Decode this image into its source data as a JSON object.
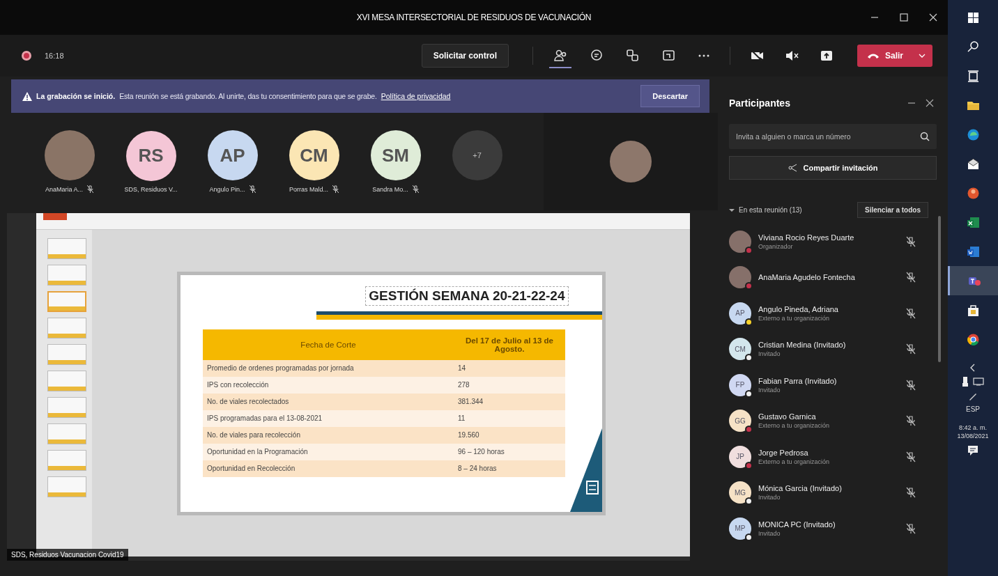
{
  "window": {
    "title": "XVI MESA INTERSECTORIAL DE RESIDUOS DE VACUNACIÓN"
  },
  "meeting_toolbar": {
    "duration": "16:18",
    "request_control": "Solicitar control",
    "tools": [
      {
        "kind": "people",
        "selected": true
      },
      {
        "kind": "chat",
        "selected": false
      },
      {
        "kind": "rooms",
        "selected": false
      },
      {
        "kind": "view",
        "selected": false
      },
      {
        "kind": "more",
        "selected": false
      }
    ],
    "devices": [
      {
        "kind": "camera-off"
      },
      {
        "kind": "speaker-muted"
      },
      {
        "kind": "share"
      }
    ],
    "leave": "Salir"
  },
  "recording_banner": {
    "title": "La grabación se inició.",
    "message": "Esta reunión se está grabando. Al unirte, das tu consentimiento para que se grabe.",
    "link": "Política de privacidad",
    "dismiss": "Descartar"
  },
  "gallery": {
    "tiles": [
      {
        "kind": "photo",
        "name": "AnaMaria A...",
        "muted": true
      },
      {
        "kind": "initials",
        "initials": "RS",
        "color": "#f4c6d6",
        "name": "SDS, Residuos V...",
        "muted": false
      },
      {
        "kind": "initials",
        "initials": "AP",
        "color": "#c7d8f0",
        "name": "Angulo Pin...",
        "muted": true
      },
      {
        "kind": "initials",
        "initials": "CM",
        "color": "#fbe6b4",
        "name": "Porras Mald...",
        "muted": true
      },
      {
        "kind": "initials",
        "initials": "SM",
        "color": "#dfecd8",
        "name": "Sandra Mo...",
        "muted": true
      }
    ],
    "overflow": "+7"
  },
  "shared_screen": {
    "thumbnails": [
      {
        "selected": false
      },
      {
        "selected": false
      },
      {
        "selected": true
      },
      {
        "selected": false
      },
      {
        "selected": false
      },
      {
        "selected": false
      },
      {
        "selected": false
      },
      {
        "selected": false
      },
      {
        "selected": false
      },
      {
        "selected": false
      }
    ],
    "slide": {
      "title": "GESTIÓN SEMANA 20-21-22-24",
      "columns": [
        "Fecha de Corte",
        "Del 17 de Julio al 13 de Agosto."
      ],
      "rows": [
        [
          "Promedio de ordenes programadas por jornada",
          "14"
        ],
        [
          "IPS con recolección",
          "278"
        ],
        [
          "No. de viales recolectados",
          "381.344"
        ],
        [
          "IPS programadas para el 13-08-2021",
          "11"
        ],
        [
          "No. de viales para recolección",
          "19.560"
        ],
        [
          "Oportunidad en la Programación",
          "96 – 120 horas"
        ],
        [
          "Oportunidad en Recolección",
          "8 – 24 horas"
        ]
      ]
    },
    "presenter_label": "SDS, Residuos Vacunacion Covid19"
  },
  "participants_panel": {
    "title": "Participantes",
    "invite_placeholder": "Invita a alguien o marca un número",
    "share_invite": "Compartir invitación",
    "section": "En esta reunión (13)",
    "mute_all": "Silenciar a todos",
    "people": [
      {
        "avatar": {
          "kind": "photo"
        },
        "name": "Viviana Rocio Reyes Duarte",
        "role": "Organizador",
        "color": "#c4314b"
      },
      {
        "avatar": {
          "kind": "photo"
        },
        "name": "AnaMaria Agudelo Fontecha",
        "color": "#c4314b"
      },
      {
        "avatar": {
          "kind": "initials",
          "initials": "AP",
          "color": "#c7d8f0"
        },
        "name": "Angulo Pineda, Adriana",
        "role": "Externo a tu organización",
        "color": "#f8d22a"
      },
      {
        "avatar": {
          "kind": "initials",
          "initials": "CM",
          "color": "#d3e6ec"
        },
        "name": "Cristian Medina (Invitado)",
        "role": "Invitado",
        "color": "#f0f0f0"
      },
      {
        "avatar": {
          "kind": "initials",
          "initials": "FP",
          "color": "#d0d8f2"
        },
        "name": "Fabian Parra (Invitado)",
        "role": "Invitado",
        "color": "#f0f0f0"
      },
      {
        "avatar": {
          "kind": "initials",
          "initials": "GG",
          "color": "#f6e2c6"
        },
        "name": "Gustavo Garnica",
        "role": "Externo a tu organización",
        "color": "#c4314b"
      },
      {
        "avatar": {
          "kind": "initials",
          "initials": "JP",
          "color": "#f0dede"
        },
        "name": "Jorge Pedrosa",
        "role": "Externo a tu organización",
        "color": "#c4314b"
      },
      {
        "avatar": {
          "kind": "initials",
          "initials": "MG",
          "color": "#f6e2c6"
        },
        "name": "Mónica Garcia (Invitado)",
        "role": "Invitado",
        "color": "#f0f0f0"
      },
      {
        "avatar": {
          "kind": "initials",
          "initials": "MP",
          "color": "#c7d8f0"
        },
        "name": "MONICA PC (Invitado)",
        "role": "Invitado",
        "color": "#f0f0f0"
      }
    ]
  },
  "taskbar": {
    "apps": [
      {
        "kind": "start",
        "selected": false
      },
      {
        "kind": "search",
        "selected": false
      },
      {
        "kind": "taskview",
        "selected": false
      },
      {
        "kind": "folder",
        "selected": false
      },
      {
        "kind": "browser",
        "selected": false
      },
      {
        "kind": "mail",
        "selected": false
      },
      {
        "kind": "office",
        "selected": false
      },
      {
        "kind": "sheet",
        "selected": false
      },
      {
        "kind": "doc",
        "selected": false
      },
      {
        "kind": "teams",
        "selected": true
      },
      {
        "kind": "store",
        "selected": false
      },
      {
        "kind": "chrome",
        "selected": false
      }
    ],
    "language": "ESP",
    "time": "8:42 a. m.",
    "date": "13/08/2021"
  }
}
